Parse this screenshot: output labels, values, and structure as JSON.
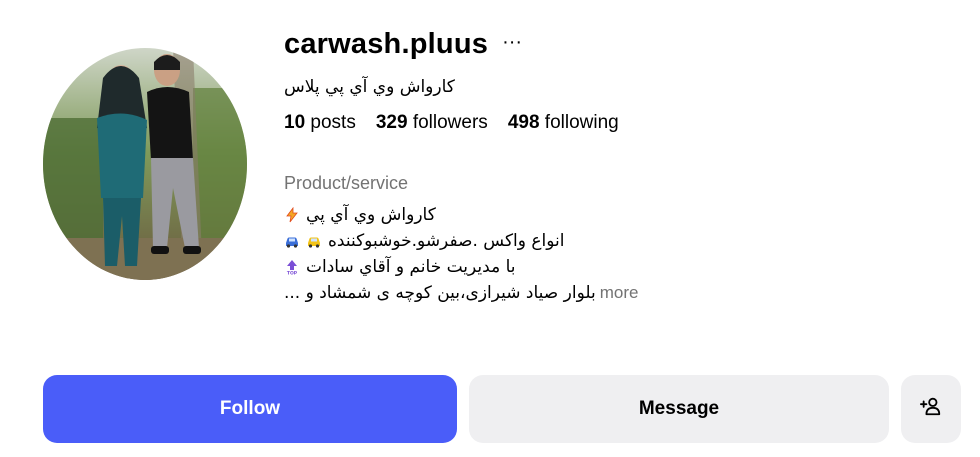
{
  "profile": {
    "username": "carwash.pluus",
    "options_icon": "more-horizontal-icon",
    "full_name": "كارواش وي آي پي پلاس",
    "avatar_icon": "profile-photo"
  },
  "stats": {
    "posts_count": "10",
    "posts_label": "posts",
    "followers_count": "329",
    "followers_label": "followers",
    "following_count": "498",
    "following_label": "following"
  },
  "bio": {
    "category": "Product/service",
    "lines": [
      {
        "text": "كارواش وي آي پي",
        "emoji": "lightning-icon"
      },
      {
        "text": "انواع واكس .صفرشو.خوشبوكننده",
        "emoji": "car-icons"
      },
      {
        "text": "با مديريت خانم و آقاي سادات",
        "emoji": "top-arrow-icon"
      },
      {
        "text": "بلوار صیاد شیرازی،بین کوچه ی شمشاد و ...",
        "emoji": ""
      }
    ],
    "more_label": "more"
  },
  "actions": {
    "follow_label": "Follow",
    "message_label": "Message",
    "suggest_icon": "add-person-icon"
  },
  "colors": {
    "follow_bg": "#4a5df9",
    "secondary_bg": "#efeff1",
    "muted_text": "#737373"
  }
}
